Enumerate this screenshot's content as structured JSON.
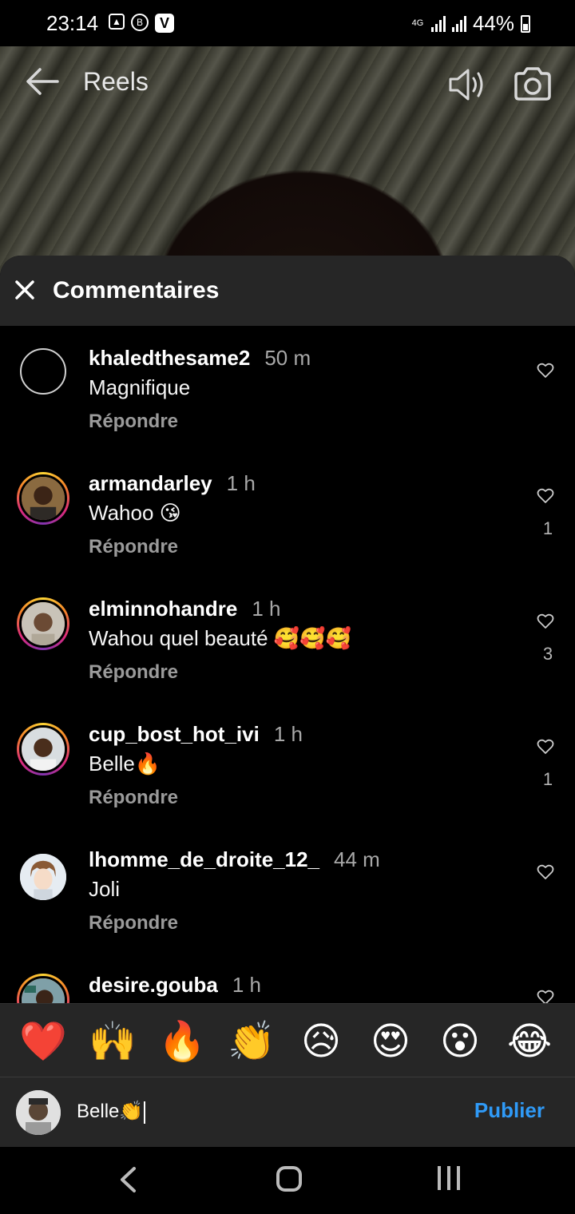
{
  "status_bar": {
    "time": "23:14",
    "network": "4G",
    "battery": "44%"
  },
  "header": {
    "title": "Reels",
    "icons": [
      "back-arrow-icon",
      "volume-icon",
      "camera-icon"
    ]
  },
  "sheet": {
    "title": "Commentaires"
  },
  "comments": [
    {
      "username": "khaledthesame2",
      "time": "50 m",
      "text": "Magnifique",
      "reply": "Répondre",
      "likes": ""
    },
    {
      "username": "armandarley",
      "time": "1 h",
      "text": "Wahoo 😘",
      "reply": "Répondre",
      "likes": "1"
    },
    {
      "username": "elminnohandre",
      "time": "1 h",
      "text": "Wahou quel beauté 🥰🥰🥰",
      "reply": "Répondre",
      "likes": "3"
    },
    {
      "username": "cup_bost_hot_ivi",
      "time": "1 h",
      "text": "Belle🔥",
      "reply": "Répondre",
      "likes": "1"
    },
    {
      "username": "lhomme_de_droite_12_",
      "time": "44 m",
      "text": "Joli",
      "reply": "Répondre",
      "likes": ""
    },
    {
      "username": "desire.gouba",
      "time": "1 h",
      "text": "",
      "reply": "",
      "likes": ""
    }
  ],
  "emoji_bar": [
    "❤️",
    "🙌",
    "🔥",
    "👏",
    "😥",
    "😍",
    "😮",
    "😂"
  ],
  "input": {
    "value": "Belle👏",
    "publish_label": "Publier"
  },
  "colors": {
    "accent": "#2f9af7",
    "sheet_header": "#262626",
    "background": "#000000"
  }
}
